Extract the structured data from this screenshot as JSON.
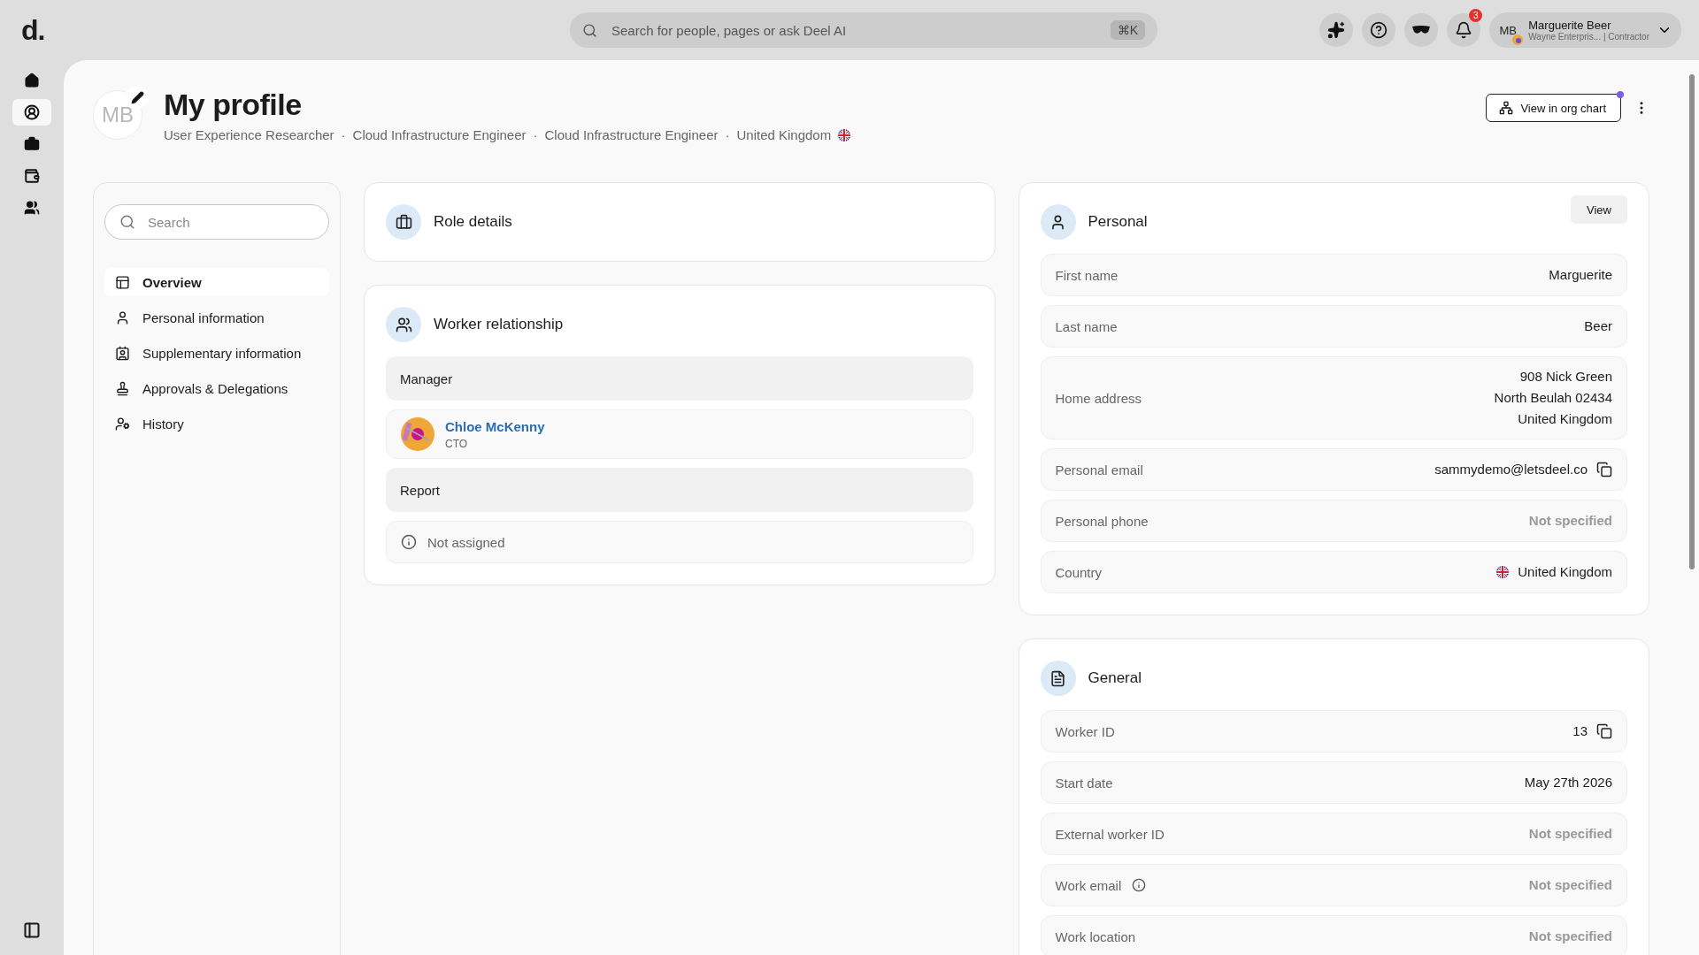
{
  "topbar": {
    "logo": "d.",
    "search": {
      "placeholder": "Search for people, pages or ask Deel AI",
      "shortcut": "⌘K"
    },
    "notifications": "3",
    "user": {
      "initials": "MB",
      "name": "Marguerite Beer",
      "subtitle": "Wayne Enterpris... | Contractor"
    }
  },
  "rail": [
    {
      "kind": "home",
      "selected": false
    },
    {
      "kind": "profile",
      "selected": true
    },
    {
      "kind": "work",
      "selected": false
    },
    {
      "kind": "wallet",
      "selected": false
    },
    {
      "kind": "team",
      "selected": false
    }
  ],
  "header": {
    "initials": "MB",
    "separator": "·",
    "title": "My profile",
    "subtitle": [
      "User Experience Researcher",
      "Cloud Infrastructure Engineer",
      "Cloud Infrastructure Engineer",
      "United Kingdom"
    ],
    "org_chart_button": "View in org chart"
  },
  "sidebar": {
    "search": {
      "placeholder": "Search"
    },
    "items": [
      {
        "kind": "overview",
        "label": "Overview",
        "selected": true
      },
      {
        "kind": "person",
        "label": "Personal information",
        "selected": false
      },
      {
        "kind": "badge",
        "label": "Supplementary information",
        "selected": false
      },
      {
        "kind": "stamp",
        "label": "Approvals & Delegations",
        "selected": false
      },
      {
        "kind": "history",
        "label": "History",
        "selected": false
      }
    ]
  },
  "role_details": {
    "title": "Role details"
  },
  "worker_relationship": {
    "title": "Worker relationship",
    "sections": [
      {
        "heading": "Manager",
        "entry": {
          "kind": "person",
          "name": "Chloe McKenny",
          "role": "CTO"
        }
      },
      {
        "heading": "Report",
        "entry": {
          "kind": "empty",
          "text": "Not assigned"
        }
      }
    ]
  },
  "personal": {
    "title": "Personal",
    "button": "View",
    "fields": [
      {
        "kind": "plain",
        "label": "First name",
        "value": [
          "Marguerite"
        ]
      },
      {
        "kind": "plain",
        "label": "Last name",
        "value": [
          "Beer"
        ]
      },
      {
        "kind": "plain",
        "label": "Home address",
        "value": [
          "908 Nick Green",
          "North Beulah 02434",
          "United Kingdom"
        ]
      },
      {
        "kind": "copy",
        "label": "Personal email",
        "value": [
          "sammydemo@letsdeel.co"
        ]
      },
      {
        "kind": "missing",
        "label": "Personal phone",
        "value": [
          "Not specified"
        ]
      },
      {
        "kind": "country",
        "label": "Country",
        "value": [
          "United Kingdom"
        ]
      }
    ]
  },
  "general": {
    "title": "General",
    "fields": [
      {
        "kind": "copy",
        "label": "Worker ID",
        "value": [
          "13"
        ]
      },
      {
        "kind": "plain",
        "label": "Start date",
        "value": [
          "May 27th 2026"
        ]
      },
      {
        "kind": "missing",
        "label": "External worker ID",
        "value": [
          "Not specified"
        ]
      },
      {
        "kind": "missing_info",
        "label": "Work email",
        "value": [
          "Not specified"
        ]
      },
      {
        "kind": "missing",
        "label": "Work location",
        "value": [
          "Not specified"
        ]
      }
    ]
  }
}
